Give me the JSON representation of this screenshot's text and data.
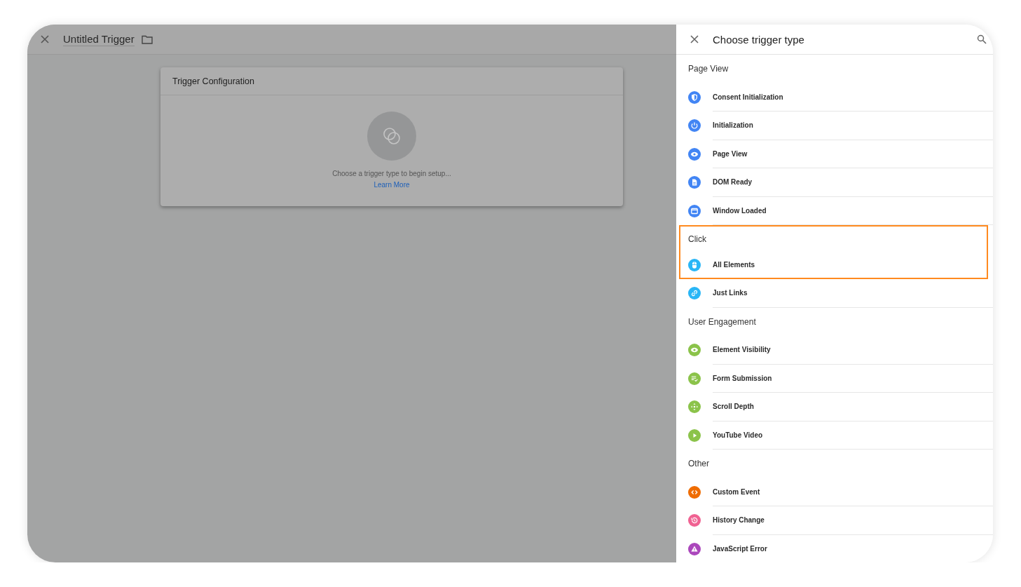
{
  "editor": {
    "title": "Untitled Trigger",
    "card": {
      "title": "Trigger Configuration",
      "prompt": "Choose a trigger type to begin setup...",
      "link": "Learn More"
    }
  },
  "panel": {
    "title": "Choose trigger type",
    "groups": [
      {
        "name": "Page View",
        "highlighted": false,
        "items": [
          {
            "label": "Consent Initialization",
            "kind": "shield",
            "color": "#4285f4",
            "highlighted": false
          },
          {
            "label": "Initialization",
            "kind": "power",
            "color": "#4285f4",
            "highlighted": false
          },
          {
            "label": "Page View",
            "kind": "eye",
            "color": "#4285f4",
            "highlighted": false
          },
          {
            "label": "DOM Ready",
            "kind": "document",
            "color": "#4285f4",
            "highlighted": false
          },
          {
            "label": "Window Loaded",
            "kind": "window",
            "color": "#4285f4",
            "highlighted": false
          }
        ]
      },
      {
        "name": "Click",
        "highlighted": true,
        "items": [
          {
            "label": "All Elements",
            "kind": "mouse",
            "color": "#29b6f6",
            "highlighted": true
          },
          {
            "label": "Just Links",
            "kind": "link",
            "color": "#29b6f6",
            "highlighted": false
          }
        ]
      },
      {
        "name": "User Engagement",
        "highlighted": false,
        "items": [
          {
            "label": "Element Visibility",
            "kind": "eye",
            "color": "#8bc34a",
            "highlighted": false
          },
          {
            "label": "Form Submission",
            "kind": "form",
            "color": "#8bc34a",
            "highlighted": false
          },
          {
            "label": "Scroll Depth",
            "kind": "move",
            "color": "#8bc34a",
            "highlighted": false
          },
          {
            "label": "YouTube Video",
            "kind": "play",
            "color": "#8bc34a",
            "highlighted": false
          }
        ]
      },
      {
        "name": "Other",
        "highlighted": false,
        "items": [
          {
            "label": "Custom Event",
            "kind": "code",
            "color": "#ef6c00",
            "highlighted": false
          },
          {
            "label": "History Change",
            "kind": "history",
            "color": "#f06292",
            "highlighted": false
          },
          {
            "label": "JavaScript Error",
            "kind": "warning",
            "color": "#ab47bc",
            "highlighted": false
          }
        ]
      }
    ]
  }
}
